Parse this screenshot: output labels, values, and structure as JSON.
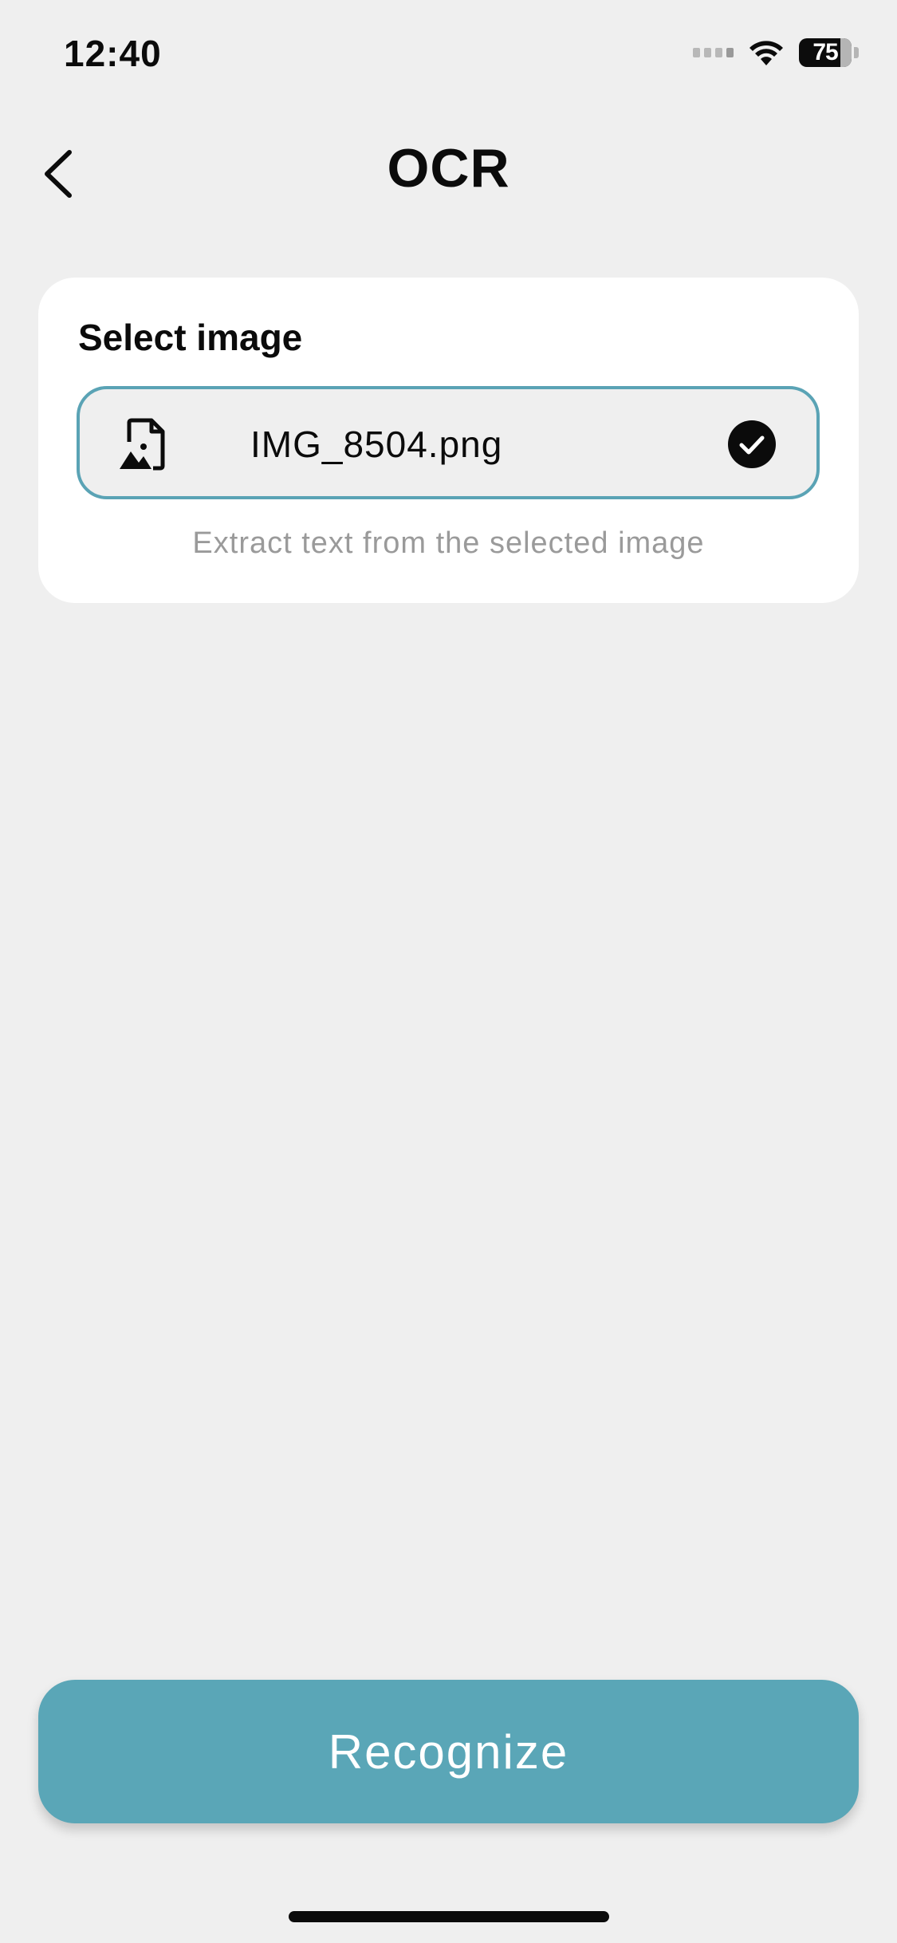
{
  "status_bar": {
    "time": "12:40",
    "battery_level": "75",
    "icons": [
      "signal-icon",
      "wifi-icon",
      "battery-icon"
    ]
  },
  "header": {
    "title": "OCR",
    "back_icon": "chevron-left-icon"
  },
  "card": {
    "heading": "Select image",
    "file": {
      "name": "IMG_8504.png",
      "icon": "image-file-icon",
      "selected": true,
      "selected_icon": "check-circle-icon"
    },
    "hint": "Extract text from the selected image"
  },
  "actions": {
    "recognize_label": "Recognize"
  },
  "colors": {
    "accent": "#5aa6b7",
    "border_accent": "#5aa3b5",
    "background": "#efefef",
    "card": "#ffffff",
    "hint_text": "#9a9a9a"
  }
}
